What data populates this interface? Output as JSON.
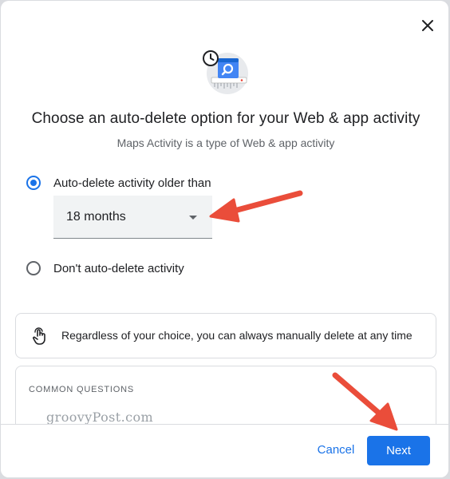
{
  "dialog": {
    "title": "Choose an auto-delete option for your Web & app activity",
    "subtitle": "Maps Activity is a type of Web & app activity",
    "close_icon": "close-icon",
    "hero_icon": "shredder-search-clock-illustration"
  },
  "options": [
    {
      "label": "Auto-delete activity older than",
      "selected": true
    },
    {
      "label": "Don't auto-delete activity",
      "selected": false
    }
  ],
  "duration_select": {
    "value": "18 months",
    "icon": "dropdown-caret-icon"
  },
  "info": {
    "icon": "touch-hand-icon",
    "text": "Regardless of your choice, you can always manually delete at any time"
  },
  "faq": {
    "heading": "COMMON QUESTIONS"
  },
  "watermark": "groovyPost.com",
  "footer": {
    "cancel_label": "Cancel",
    "next_label": "Next"
  },
  "colors": {
    "accent": "#1a73e8",
    "annotation_arrow": "#ea4d3a",
    "select_fill": "#f1f3f4",
    "text_primary": "#202124",
    "text_secondary": "#5f6368"
  }
}
